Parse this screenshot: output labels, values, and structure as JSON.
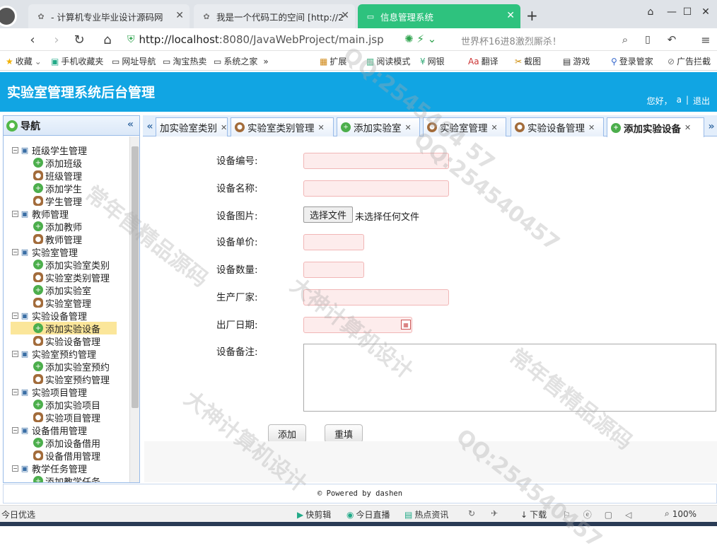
{
  "browser": {
    "tabs": [
      {
        "label": "- 计算机专业毕业设计源码网",
        "icon": "paw-icon"
      },
      {
        "label": "我是一个代码工的空间 [http://2",
        "icon": "paw-icon"
      },
      {
        "label": "信息管理系统",
        "icon": "page-icon"
      }
    ],
    "url_host": "http://localhost",
    "url_rest": ":8080/JavaWebProject/main.jsp",
    "hot_search": "世界杯16进8激烈厮杀！",
    "bookmarks": [
      "收藏",
      "手机收藏夹",
      "网址导航",
      "淘宝热卖",
      "系统之家"
    ],
    "tools": [
      "扩展",
      "阅读模式",
      "网银",
      "翻译",
      "截图",
      "游戏",
      "登录管家",
      "广告拦截"
    ]
  },
  "app": {
    "title": "实验室管理系统后台管理",
    "greeting": "您好，",
    "username": "a",
    "sep": "|",
    "logout": "退出"
  },
  "sidebar": {
    "title": "导航",
    "groups": [
      {
        "label": "班级学生管理",
        "items": [
          "添加班级",
          "班级管理",
          "添加学生",
          "学生管理"
        ]
      },
      {
        "label": "教师管理",
        "items": [
          "添加教师",
          "教师管理"
        ]
      },
      {
        "label": "实验室管理",
        "items": [
          "添加实验室类别",
          "实验室类别管理",
          "添加实验室",
          "实验室管理"
        ]
      },
      {
        "label": "实验设备管理",
        "items": [
          "添加实验设备",
          "实验设备管理"
        ]
      },
      {
        "label": "实验室预约管理",
        "items": [
          "添加实验室预约",
          "实验室预约管理"
        ]
      },
      {
        "label": "实验项目管理",
        "items": [
          "添加实验项目",
          "实验项目管理"
        ]
      },
      {
        "label": "设备借用管理",
        "items": [
          "添加设备借用",
          "设备借用管理"
        ]
      },
      {
        "label": "教学任务管理",
        "items": [
          "添加教学任务"
        ]
      }
    ]
  },
  "tabs": [
    "加实验室类别",
    "实验室类别管理",
    "添加实验室",
    "实验室管理",
    "实验设备管理",
    "添加实验设备"
  ],
  "form": {
    "labels": [
      "设备编号:",
      "设备名称:",
      "设备图片:",
      "设备单价:",
      "设备数量:",
      "生产厂家:",
      "出厂日期:",
      "设备备注:"
    ],
    "file_button": "选择文件",
    "file_status": "未选择任何文件",
    "submit": "添加",
    "reset": "重填"
  },
  "footer": "© Powered by dashen",
  "statusbar": {
    "left": "今日优选",
    "items": [
      "快剪辑",
      "今日直播",
      "热点资讯",
      "下载"
    ],
    "zoom": "100%"
  },
  "watermark": [
    "大神计算机设计",
    "QQ:2545404 57",
    "常年售精品源码",
    "QQ:254540457",
    "大神计算机设计",
    "常年售精品源码",
    "QQ:254540457"
  ]
}
